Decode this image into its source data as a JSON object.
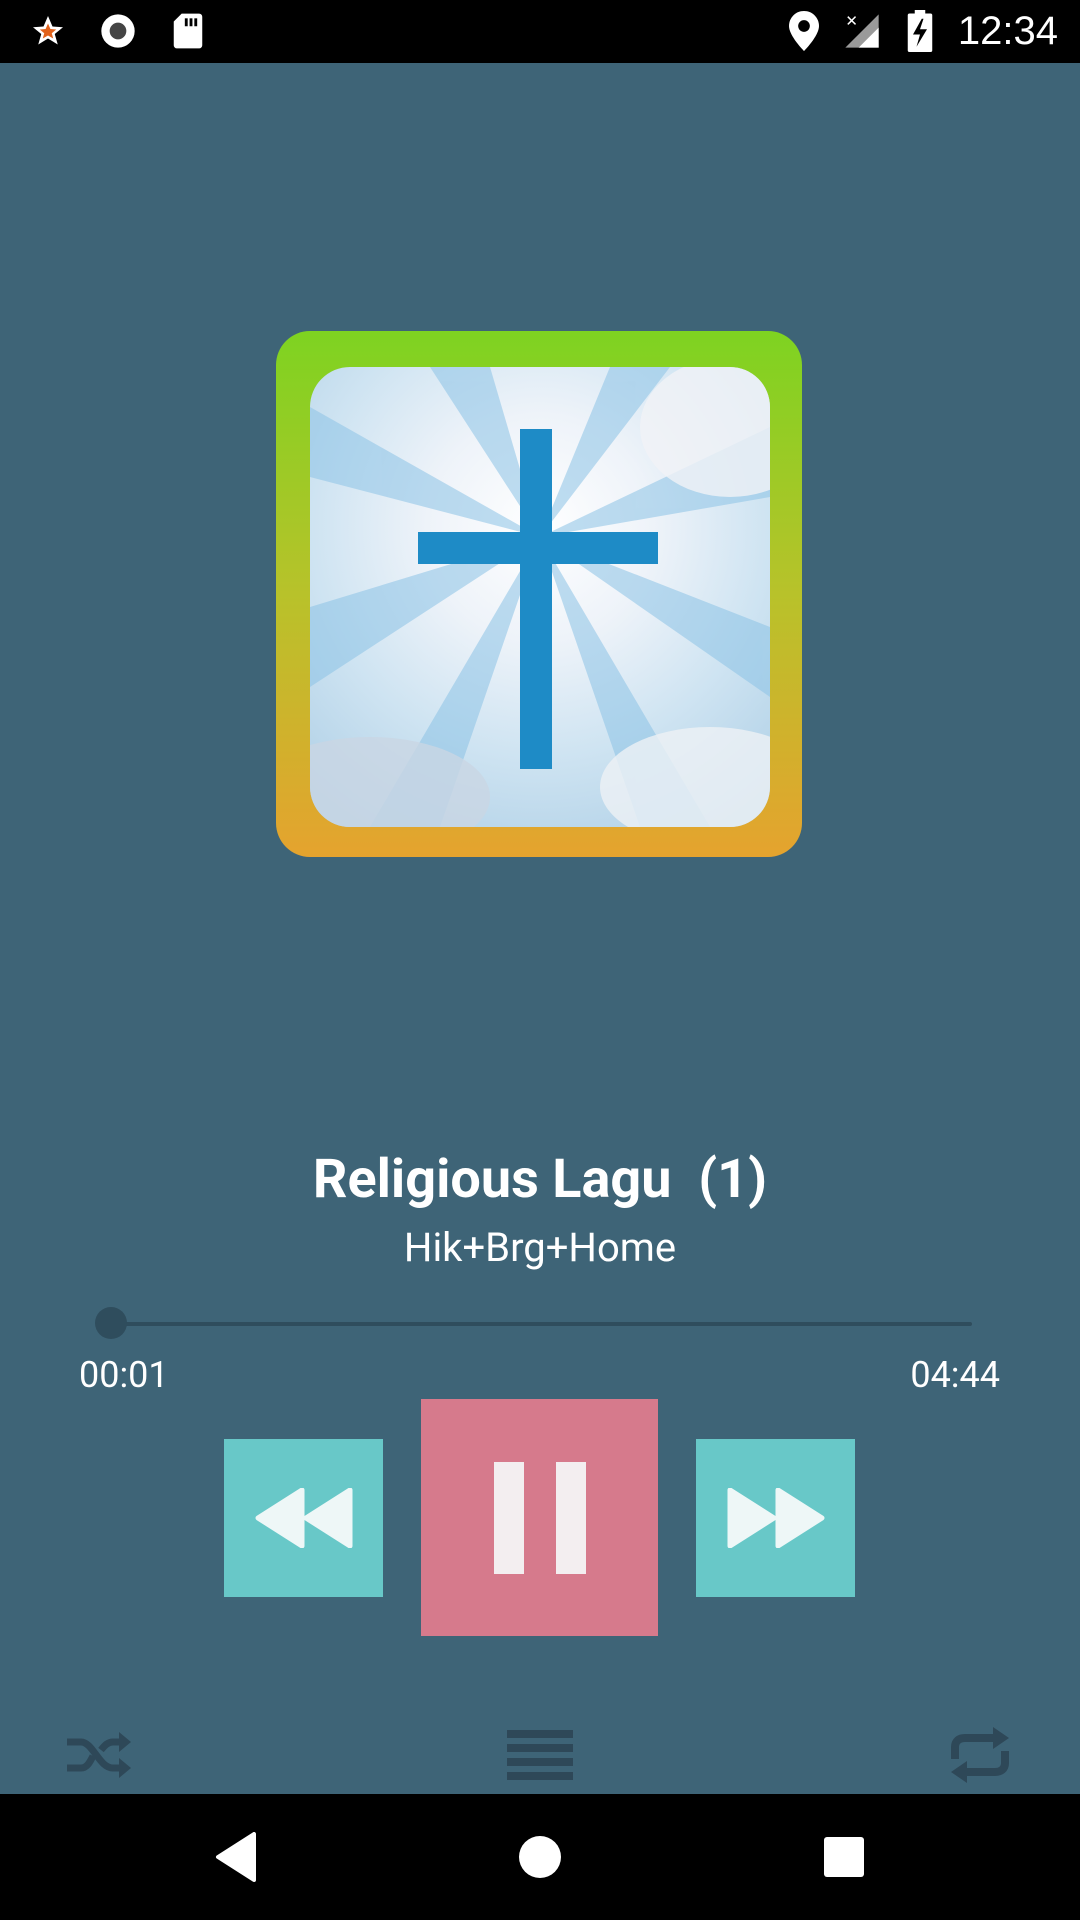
{
  "status_bar": {
    "time": "12:34",
    "left_icons": [
      "star-notification-icon",
      "record-icon",
      "sd-card-icon"
    ],
    "right_icons": [
      "location-icon",
      "signal-icon",
      "battery-charging-icon"
    ]
  },
  "player": {
    "album_art": "cross-album-art",
    "song_title": "Religious Lagu  (1)",
    "artist": "Hik+Brg+Home",
    "progress": {
      "elapsed": "00:01",
      "total": "04:44",
      "fraction": 0.004
    },
    "controls": {
      "previous": "rewind-icon",
      "play_pause": "pause-icon",
      "next": "fast-forward-icon"
    },
    "bottom_bar": {
      "shuffle": "shuffle-icon",
      "playlist": "playlist-icon",
      "repeat": "repeat-icon"
    }
  },
  "nav_bar": {
    "back": "back-icon",
    "home": "home-icon",
    "recents": "recents-icon"
  },
  "colors": {
    "background": "#3e6477",
    "accent_teal": "#68c8c8",
    "accent_pink": "#d67a8c",
    "track": "#2f4d5d"
  }
}
